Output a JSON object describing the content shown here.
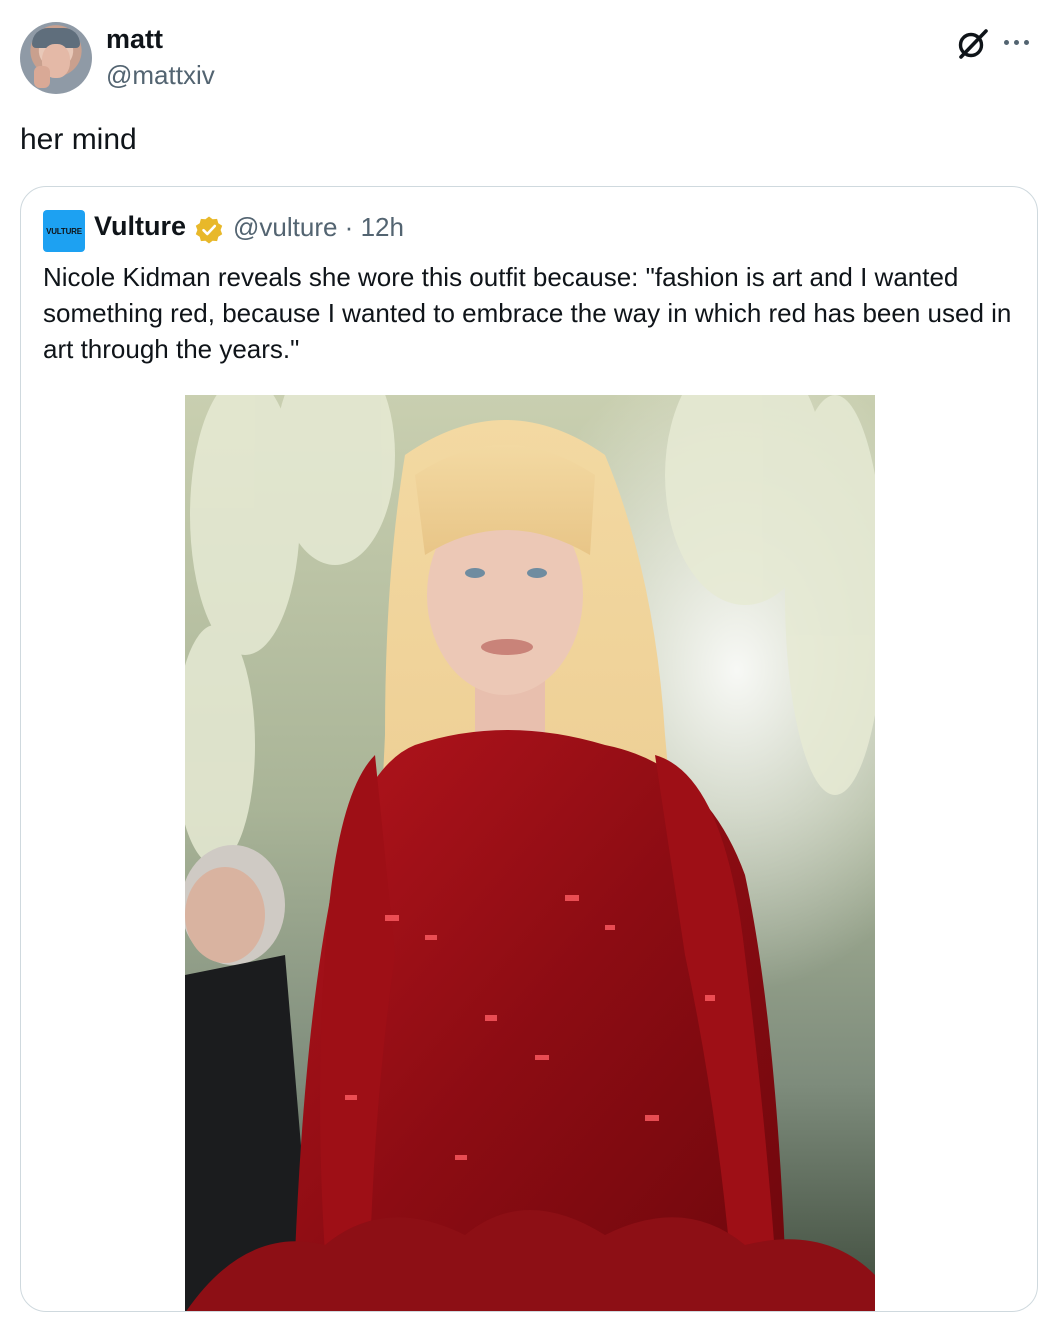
{
  "author": {
    "display_name": "matt",
    "handle": "@mattxiv"
  },
  "tweet": {
    "text": "her mind"
  },
  "quoted_tweet": {
    "logo_text": "VULTURE",
    "display_name": "Vulture",
    "handle": "@vulture",
    "separator": "·",
    "time": "12h",
    "text": "Nicole Kidman reveals she wore this outfit because: \"fashion is art and I wanted something red, because I wanted to embrace the way in which red has been used in art through the years.\"",
    "verified_color": "#e8b82a"
  },
  "icons": {
    "grok": "grok-icon",
    "more": "more-icon",
    "verified": "verified-badge-icon"
  },
  "colors": {
    "text_primary": "#0f1419",
    "text_secondary": "#536471",
    "border": "#cfd9de",
    "logo_bg": "#1da1f2",
    "dress_red": "#9a0f14"
  }
}
